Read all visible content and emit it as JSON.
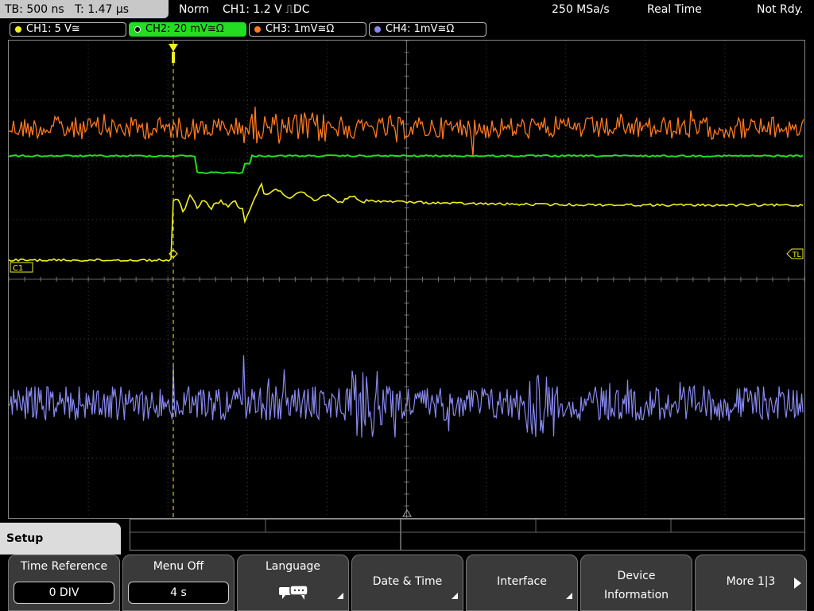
{
  "status": {
    "timebase": "TB: 500 ns",
    "trigger_time": "T: 1.47 µs",
    "mode": "Norm",
    "trigger_setting": "CH1: 1.2 V ⎍DC",
    "sample_rate": "250 MSa/s",
    "acq_mode": "Real Time",
    "ready_state": "Not Rdy."
  },
  "channels": [
    {
      "label": "CH1: 5 V≅",
      "color": "#f0f020"
    },
    {
      "label": "CH2: 20 mV≅Ω",
      "color": "#22dd22"
    },
    {
      "label": "CH3: 1mV≅Ω",
      "color": "#ff7a20"
    },
    {
      "label": "CH4: 1mV≅Ω",
      "color": "#8888ee"
    }
  ],
  "markers": {
    "ch1_label": "C1",
    "trigger_level_label": "TL"
  },
  "menu": {
    "title": "Setup",
    "softkeys": [
      {
        "label": "Time Reference",
        "value": "0 DIV"
      },
      {
        "label": "Menu Off",
        "value": "4 s"
      },
      {
        "label": "Language",
        "icon": "language-icon"
      },
      {
        "label": "Date & Time"
      },
      {
        "label": "Interface"
      },
      {
        "label_line1": "Device",
        "label_line2": "Information"
      },
      {
        "label": "More 1|3"
      }
    ]
  },
  "colors": {
    "ch1": "#f0f020",
    "ch2": "#22dd22",
    "ch3": "#ff7a20",
    "ch4": "#8888ee",
    "grid": "#555555"
  }
}
